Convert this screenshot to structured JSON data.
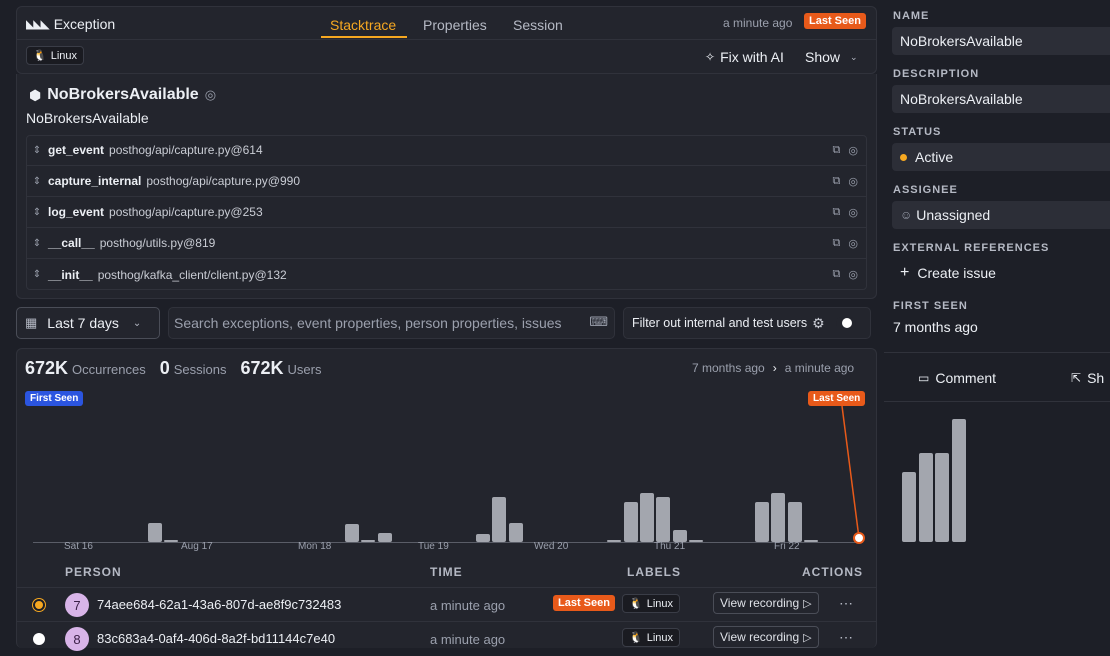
{
  "header": {
    "title": "Exception",
    "tabs": [
      {
        "label": "Stacktrace",
        "active": true
      },
      {
        "label": "Properties",
        "active": false
      },
      {
        "label": "Session",
        "active": false
      }
    ],
    "last_time": "a minute ago",
    "last_seen_badge": "Last Seen",
    "os_chip": "Linux",
    "fix_ai": "Fix with AI",
    "show": "Show"
  },
  "exception": {
    "type": "NoBrokersAvailable",
    "message": "NoBrokersAvailable",
    "frames": [
      {
        "fn": "get_event",
        "path": "posthog/api/capture.py@614"
      },
      {
        "fn": "capture_internal",
        "path": "posthog/api/capture.py@990"
      },
      {
        "fn": "log_event",
        "path": "posthog/api/capture.py@253"
      },
      {
        "fn": "__call__",
        "path": "posthog/utils.py@819"
      },
      {
        "fn": "__init__",
        "path": "posthog/kafka_client/client.py@132"
      }
    ]
  },
  "filters": {
    "date_range": "Last 7 days",
    "search_placeholder": "Search exceptions, event properties, person properties, issues",
    "filter_internal": "Filter out internal and test users"
  },
  "stats": {
    "occurrences_value": "672K",
    "occurrences_label": "Occurrences",
    "sessions_value": "0",
    "sessions_label": "Sessions",
    "users_value": "672K",
    "users_label": "Users",
    "first_time": "7 months ago",
    "last_time": "a minute ago"
  },
  "chart_data": {
    "type": "bar",
    "x_ticks": [
      "Sat 16",
      "Aug 17",
      "Mon 18",
      "Tue 19",
      "Wed 20",
      "Thu 21",
      "Fri 22"
    ],
    "values": [
      0,
      0,
      0,
      0,
      0,
      0,
      0,
      14,
      1,
      0,
      0,
      0,
      0,
      0,
      0,
      0,
      0,
      0,
      0,
      13,
      1,
      7,
      0,
      0,
      0,
      0,
      0,
      6,
      33,
      14,
      0,
      0,
      0,
      0,
      0,
      1,
      30,
      36,
      33,
      9,
      1,
      0,
      0,
      0,
      30,
      36,
      30,
      1,
      0,
      0,
      0,
      0,
      0,
      52,
      66,
      66,
      91
    ],
    "ylim": [
      0,
      100
    ],
    "first_seen_label": "First Seen",
    "last_seen_label": "Last Seen",
    "bar_color": "#a3a6ae",
    "marker_color": "#e85a1a"
  },
  "table": {
    "headers": {
      "person": "PERSON",
      "time": "TIME",
      "labels": "LABELS",
      "actions": "ACTIONS"
    },
    "rows": [
      {
        "avatar": "7",
        "person": "74aee684-62a1-43a6-807d-ae8f9c732483",
        "time": "a minute ago",
        "badge": "Last Seen",
        "os": "Linux",
        "action": "View recording",
        "dot": "#f6a821"
      },
      {
        "avatar": "8",
        "person": "83c683a4-0af4-406d-8a2f-bd11144c7e40",
        "time": "a minute ago",
        "badge": "",
        "os": "Linux",
        "action": "View recording",
        "dot": "#ffffff"
      }
    ]
  },
  "sidebar": {
    "name_label": "NAME",
    "name_value": "NoBrokersAvailable",
    "description_label": "DESCRIPTION",
    "description_value": "NoBrokersAvailable",
    "status_label": "STATUS",
    "status_value": "Active",
    "assignee_label": "ASSIGNEE",
    "assignee_value": "Unassigned",
    "ext_ref_label": "EXTERNAL REFERENCES",
    "create_issue": "Create issue",
    "first_seen_label": "FIRST SEEN",
    "first_seen_value": "7 months ago",
    "comment": "Comment",
    "share": "Sh"
  }
}
